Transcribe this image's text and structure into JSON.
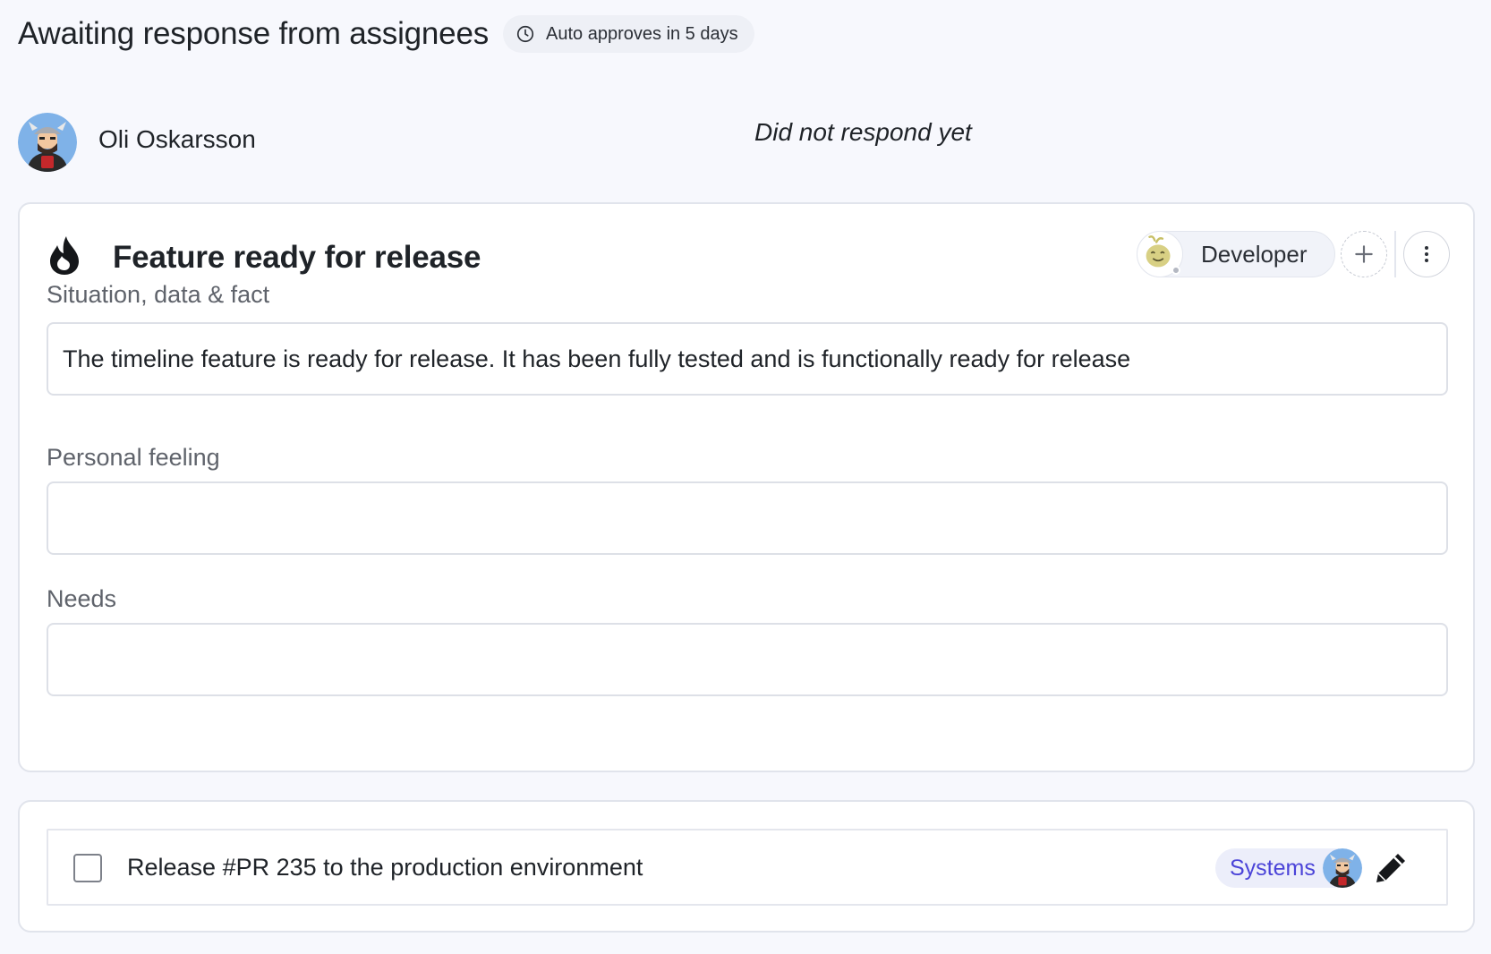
{
  "header": {
    "title": "Awaiting response from assignees",
    "auto_approve": "Auto approves in 5 days"
  },
  "assignee": {
    "name": "Oli Oskarsson",
    "status": "Did not respond yet"
  },
  "card": {
    "title": "Feature ready for release",
    "role": "Developer",
    "fields": [
      {
        "label": "Situation, data & fact",
        "value": "The timeline feature is ready for release. It has been fully tested and is functionally ready for release"
      },
      {
        "label": "Personal feeling",
        "value": ""
      },
      {
        "label": "Needs",
        "value": ""
      }
    ]
  },
  "task": {
    "text": "Release #PR 235 to the production environment",
    "tag": "Systems",
    "checked": false
  },
  "colors": {
    "background": "#f7f8fd",
    "tag_text": "#4b44d8",
    "tag_bg": "#eceefa",
    "role_icon": "#c8c067"
  }
}
